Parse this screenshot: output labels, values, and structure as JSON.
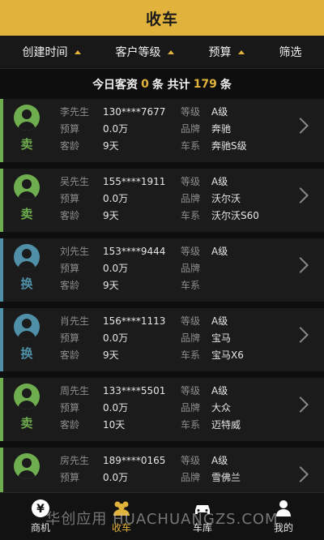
{
  "header": {
    "title": "收车"
  },
  "filters": [
    {
      "label": "创建时间"
    },
    {
      "label": "客户等级"
    },
    {
      "label": "预算"
    },
    {
      "label": "筛选"
    }
  ],
  "summary": {
    "prefix": "今日客资",
    "today": "0",
    "mid": "条 共计",
    "total": "179",
    "suffix": "条"
  },
  "labels": {
    "budget": "预算",
    "age": "客龄",
    "level": "等级",
    "brand": "品牌",
    "series": "车系"
  },
  "customers": [
    {
      "name": "李先生",
      "phone": "130****7677",
      "budget": "0.0万",
      "age": "9天",
      "level": "A级",
      "brand": "奔驰",
      "series": "奔驰S级",
      "tag": "卖"
    },
    {
      "name": "吴先生",
      "phone": "155****1911",
      "budget": "0.0万",
      "age": "9天",
      "level": "A级",
      "brand": "沃尔沃",
      "series": "沃尔沃S60",
      "tag": "卖"
    },
    {
      "name": "刘先生",
      "phone": "153****9444",
      "budget": "0.0万",
      "age": "9天",
      "level": "A级",
      "brand": "",
      "series": "",
      "tag": "换"
    },
    {
      "name": "肖先生",
      "phone": "156****1113",
      "budget": "0.0万",
      "age": "9天",
      "level": "A级",
      "brand": "宝马",
      "series": "宝马X6",
      "tag": "换"
    },
    {
      "name": "周先生",
      "phone": "133****5501",
      "budget": "0.0万",
      "age": "10天",
      "level": "A级",
      "brand": "大众",
      "series": "迈特威",
      "tag": "卖"
    },
    {
      "name": "房先生",
      "phone": "189****0165",
      "budget": "0.0万",
      "age": "",
      "level": "A级",
      "brand": "雪佛兰",
      "series": "",
      "tag": ""
    }
  ],
  "tabs": [
    {
      "label": "商机",
      "icon": "yen-icon"
    },
    {
      "label": "收车",
      "icon": "users-icon"
    },
    {
      "label": "车库",
      "icon": "car-icon"
    },
    {
      "label": "我的",
      "icon": "person-icon"
    }
  ],
  "watermark": "华创应用 HUACHUANGZS.COM",
  "colors": {
    "accent": "#e1b33c",
    "sell": "#6fae4f",
    "swap": "#4f90a8"
  }
}
